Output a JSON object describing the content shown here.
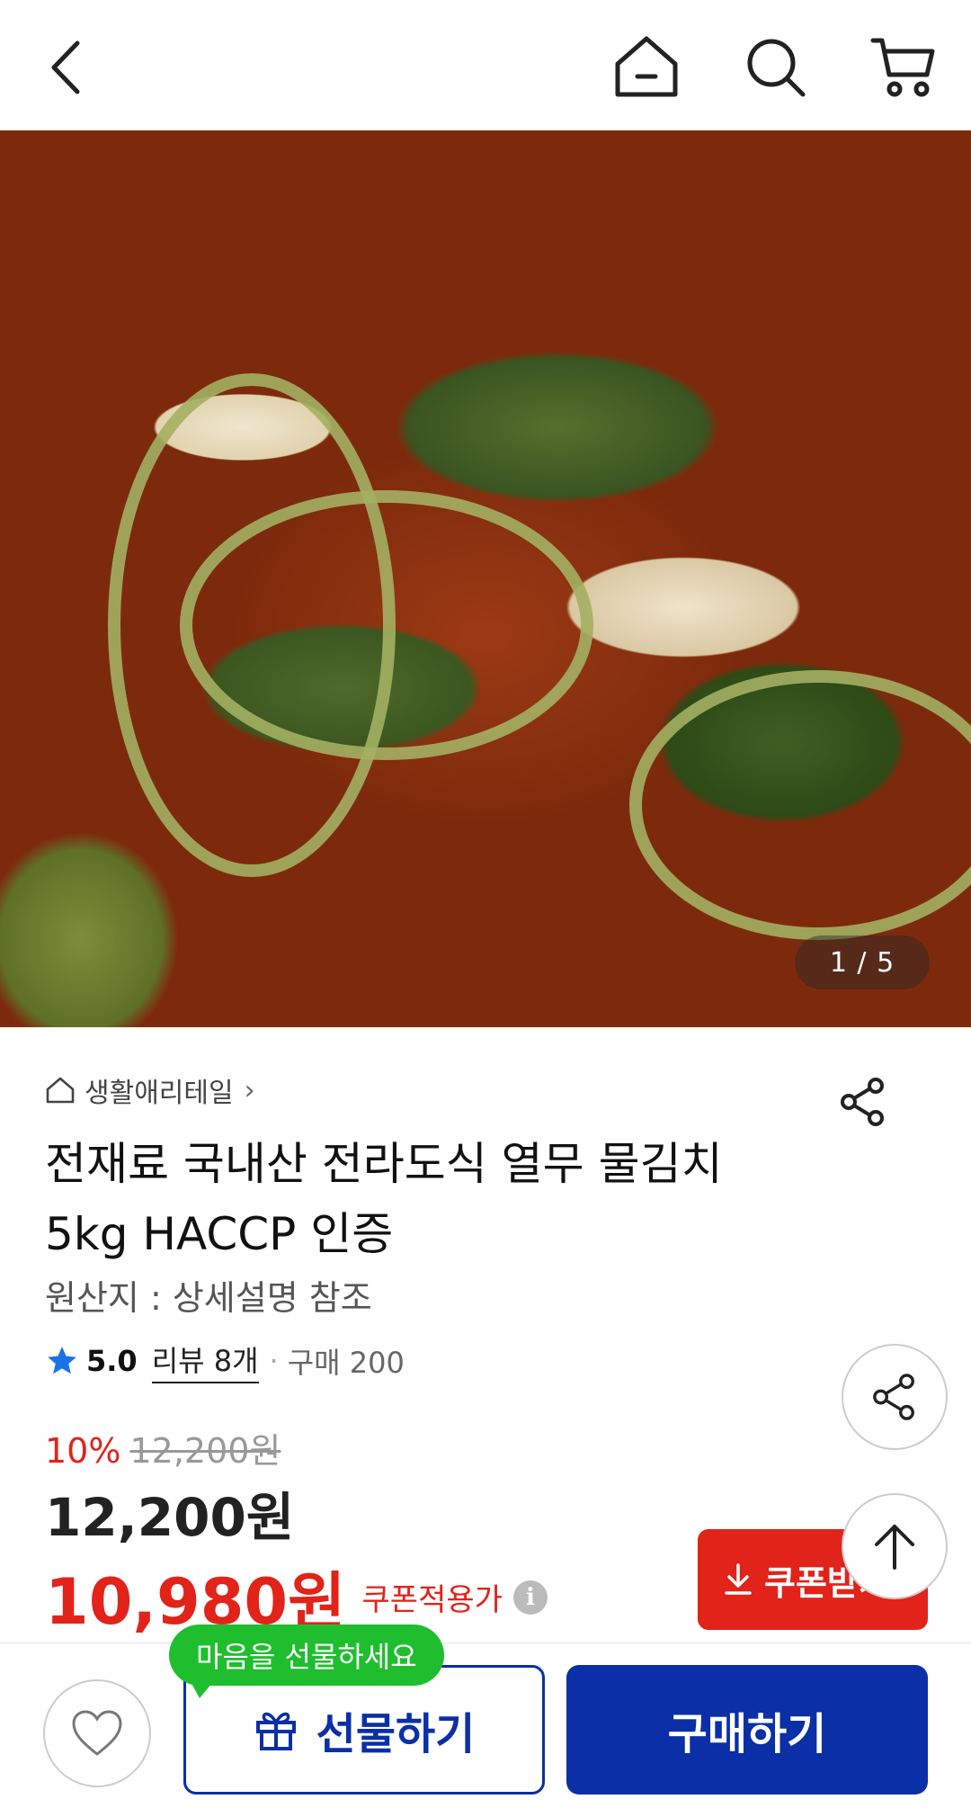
{
  "header": {
    "back_icon": "back-arrow-icon",
    "home_icon": "home-icon",
    "search_icon": "search-icon",
    "cart_icon": "cart-icon"
  },
  "gallery": {
    "counter": "1 / 5"
  },
  "product": {
    "category": "생활애리테일",
    "title": "전재료 국내산 전라도식 열무 물김치 5kg HACCP 인증",
    "origin": "원산지 : 상세설명 참조",
    "rating": "5.0",
    "reviews": "리뷰 8개",
    "separator": "·",
    "purchases": "구매 200",
    "discount_pct": "10%",
    "original_price": "12,200원",
    "price": "12,200원",
    "coupon_price": "10,980원",
    "coupon_price_label": "쿠폰적용가",
    "info_glyph": "i"
  },
  "actions": {
    "coupon_button": "쿠폰받기",
    "gift_bubble": "마음을 선물하세요",
    "gift_button": "선물하기",
    "buy_button": "구매하기"
  },
  "colors": {
    "brand_blue": "#0a2fa6",
    "sale_red": "#e2231a",
    "bubble_green": "#1fbe2f",
    "star_blue": "#1a73e8"
  }
}
